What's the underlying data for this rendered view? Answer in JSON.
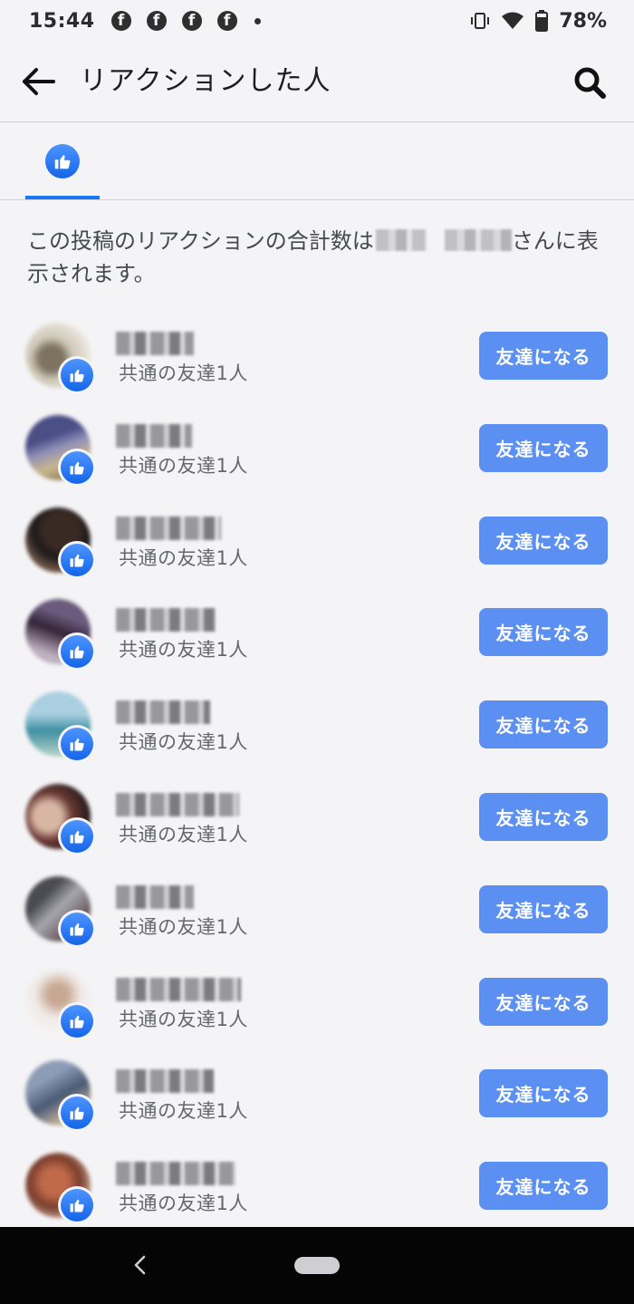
{
  "status_bar": {
    "time": "15:44",
    "notification_icons": [
      "facebook-icon",
      "facebook-icon",
      "facebook-icon",
      "facebook-icon"
    ],
    "battery": "78%"
  },
  "header": {
    "title": "リアクションした人"
  },
  "tabs": [
    {
      "icon": "like-icon",
      "selected": true
    }
  ],
  "summary": {
    "before": "この投稿のリアクションの合計数は",
    "after": "さんに表示されます。"
  },
  "people": [
    {
      "mutual": "共通の友達1人",
      "button": "友達になる"
    },
    {
      "mutual": "共通の友達1人",
      "button": "友達になる"
    },
    {
      "mutual": "共通の友達1人",
      "button": "友達になる"
    },
    {
      "mutual": "共通の友達1人",
      "button": "友達になる"
    },
    {
      "mutual": "共通の友達1人",
      "button": "友達になる"
    },
    {
      "mutual": "共通の友達1人",
      "button": "友達になる"
    },
    {
      "mutual": "共通の友達1人",
      "button": "友達になる"
    },
    {
      "mutual": "共通の友達1人",
      "button": "友達になる"
    },
    {
      "mutual": "共通の友達1人",
      "button": "友達になる"
    },
    {
      "mutual": "共通の友達1人",
      "button": "友達になる"
    }
  ],
  "colors": {
    "accent": "#1877f2",
    "button": "#5b8ff2",
    "background": "#f4f4f6"
  }
}
